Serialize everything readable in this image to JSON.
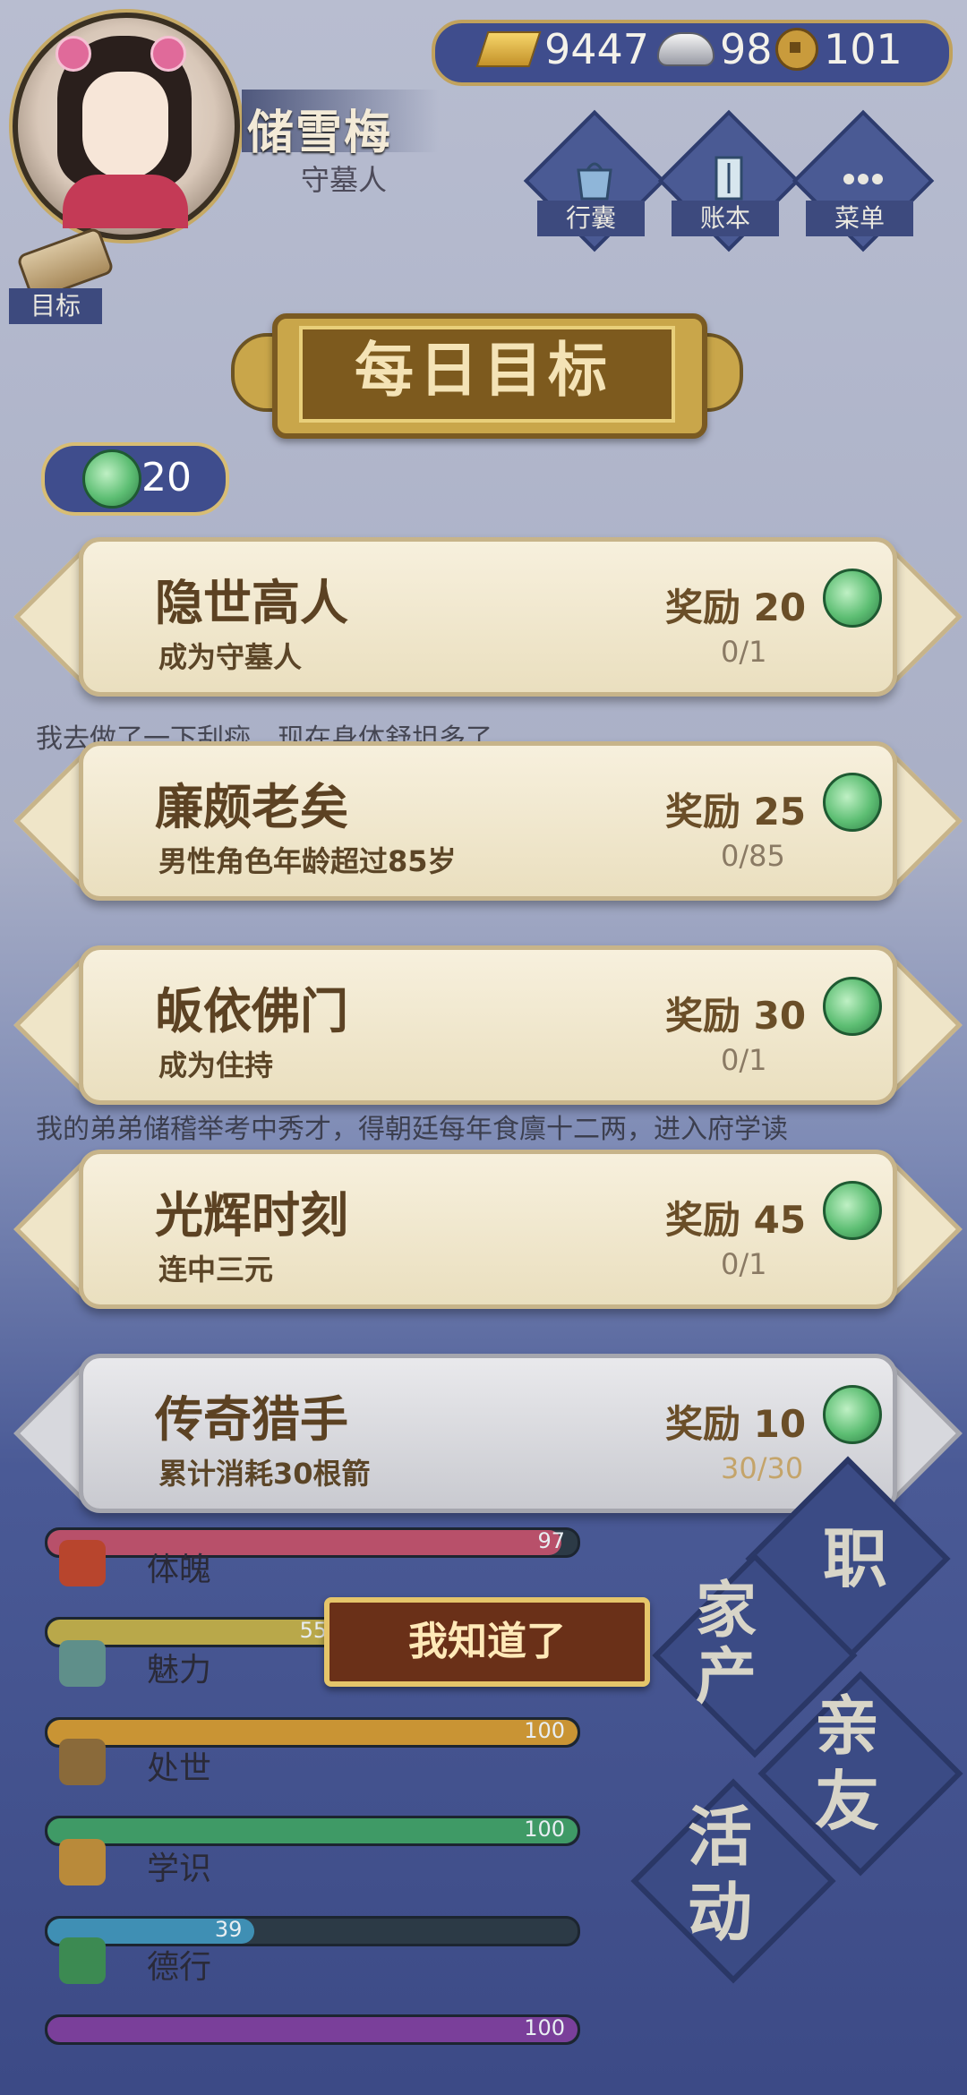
{
  "player": {
    "name": "储雪梅",
    "title": "守墓人"
  },
  "resources": {
    "gold": "9447",
    "silver": "98",
    "coin": "101"
  },
  "top_menu": [
    {
      "label": "行囊",
      "icon": "bag-icon"
    },
    {
      "label": "账本",
      "icon": "ledger-icon"
    },
    {
      "label": "菜单",
      "icon": "menu-dots-icon"
    }
  ],
  "goal_button_label": "目标",
  "log_lines": [
    "我去做了一下刮痧，现在身体舒坦多了",
    "我的弟弟储稽举考中秀才，得朝廷每年食廪十二两，进入府学读"
  ],
  "dialog": {
    "title": "每日目标",
    "total_reward": "20",
    "reward_prefix": "奖励",
    "confirm_label": "我知道了",
    "goals": [
      {
        "title": "隐世高人",
        "desc": "成为守墓人",
        "reward": "20",
        "progress": "0/1",
        "done": false
      },
      {
        "title": "廉颇老矣",
        "desc": "男性角色年龄超过85岁",
        "reward": "25",
        "progress": "0/85",
        "done": false
      },
      {
        "title": "皈依佛门",
        "desc": "成为住持",
        "reward": "30",
        "progress": "0/1",
        "done": false
      },
      {
        "title": "光辉时刻",
        "desc": "连中三元",
        "reward": "45",
        "progress": "0/1",
        "done": false
      },
      {
        "title": "传奇猎手",
        "desc": "累计消耗30根箭",
        "reward": "10",
        "progress": "30/30",
        "done": true
      }
    ]
  },
  "attributes": [
    {
      "label": "",
      "value": "97",
      "fraction": 0.97,
      "color": "#b8506a"
    },
    {
      "label": "体魄",
      "value": "55",
      "fraction": 0.55,
      "color": "#b9a84a",
      "icon": "fire-hydrant-icon",
      "icon_color": "#b8452d"
    },
    {
      "label": "魅力",
      "value": "100",
      "fraction": 1.0,
      "color": "#c99434",
      "icon": "mirror-icon",
      "icon_color": "#5f8f8a"
    },
    {
      "label": "处世",
      "value": "100",
      "fraction": 1.0,
      "color": "#3f9a66",
      "icon": "hat-icon",
      "icon_color": "#8a6a3a"
    },
    {
      "label": "学识",
      "value": "39",
      "fraction": 0.39,
      "color": "#3f8fb4",
      "icon": "book-basket-icon",
      "icon_color": "#b98a3a"
    },
    {
      "label": "德行",
      "value": "100",
      "fraction": 1.0,
      "color": "#7a3f9a",
      "icon": "beads-icon",
      "icon_color": "#3c8a52"
    }
  ],
  "side_nav": [
    {
      "label": "职"
    },
    {
      "label": "家产"
    },
    {
      "label": "亲友"
    },
    {
      "label": "活动"
    }
  ],
  "colors": {
    "hud_blue": "#3f4d8d",
    "gold_trim": "#c9a64a",
    "card_bg": "#f1e7cc"
  }
}
